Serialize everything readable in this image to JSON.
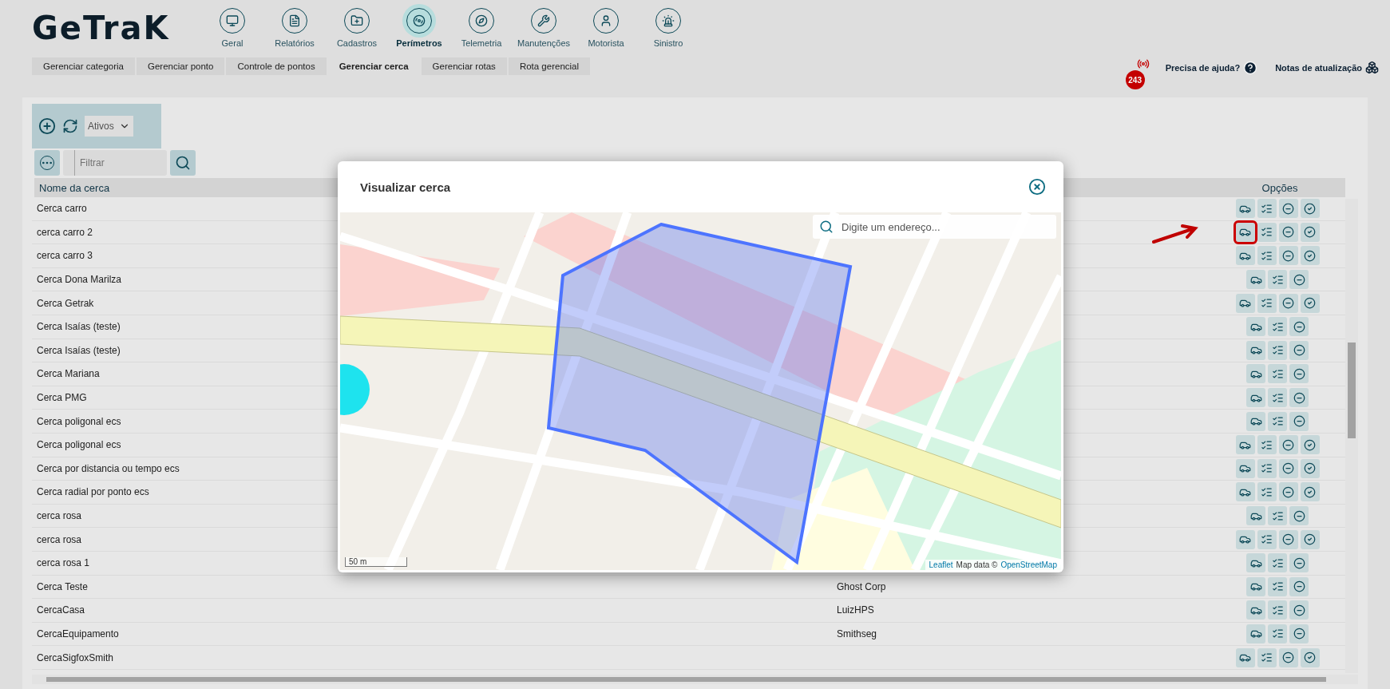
{
  "logo": "GeTraK",
  "nav": {
    "items": [
      {
        "label": "Geral",
        "selected": false
      },
      {
        "label": "Relatórios",
        "selected": false
      },
      {
        "label": "Cadastros",
        "selected": false
      },
      {
        "label": "Perímetros",
        "selected": true
      },
      {
        "label": "Telemetria",
        "selected": false
      },
      {
        "label": "Manutenções",
        "selected": false
      },
      {
        "label": "Motorista",
        "selected": false
      },
      {
        "label": "Sinistro",
        "selected": false
      }
    ]
  },
  "subtabs": [
    {
      "label": "Gerenciar categoria",
      "selected": false
    },
    {
      "label": "Gerenciar ponto",
      "selected": false
    },
    {
      "label": "Controle de pontos",
      "selected": false
    },
    {
      "label": "Gerenciar cerca",
      "selected": true
    },
    {
      "label": "Gerenciar rotas",
      "selected": false
    },
    {
      "label": "Rota gerencial",
      "selected": false
    }
  ],
  "alerts": {
    "badge": "243"
  },
  "help": {
    "label": "Precisa de ajuda?"
  },
  "release_notes": {
    "label": "Notas de atualização"
  },
  "toolbar": {
    "status_select": "Ativos",
    "filter": {
      "placeholder": "Filtrar"
    }
  },
  "table": {
    "columns": [
      "Nome da cerca",
      "Opções"
    ],
    "rows": [
      {
        "name": "Cerca carro",
        "check_option": true,
        "highlighted": false
      },
      {
        "name": "cerca carro 2",
        "check_option": true,
        "highlighted": true
      },
      {
        "name": "cerca carro 3",
        "check_option": true,
        "highlighted": false
      },
      {
        "name": "Cerca Dona Marilza",
        "check_option": false,
        "highlighted": false
      },
      {
        "name": "Cerca Getrak",
        "check_option": true,
        "highlighted": false
      },
      {
        "name": "Cerca Isaías (teste)",
        "check_option": false,
        "highlighted": false
      },
      {
        "name": "Cerca Isaías (teste)",
        "check_option": false,
        "highlighted": false
      },
      {
        "name": "Cerca Mariana",
        "check_option": false,
        "highlighted": false
      },
      {
        "name": "Cerca PMG",
        "check_option": false,
        "highlighted": false
      },
      {
        "name": "Cerca poligonal ecs",
        "check_option": false,
        "highlighted": false
      },
      {
        "name": "Cerca poligonal ecs",
        "check_option": true,
        "highlighted": false
      },
      {
        "name": "Cerca por distancia ou tempo ecs",
        "check_option": true,
        "highlighted": false
      },
      {
        "name": "Cerca radial por ponto ecs",
        "check_option": true,
        "highlighted": false
      },
      {
        "name": "cerca rosa",
        "check_option": false,
        "highlighted": false
      },
      {
        "name": "cerca rosa",
        "check_option": true,
        "highlighted": false
      },
      {
        "name": "cerca rosa 1",
        "check_option": false,
        "highlighted": false
      },
      {
        "name": "Cerca Teste",
        "column_2": "Ghost Corp",
        "check_option": false,
        "highlighted": false
      },
      {
        "name": "CercaCasa",
        "column_2": "LuizHPS",
        "check_option": false,
        "highlighted": false
      },
      {
        "name": "CercaEquipamento",
        "column_2": "Smithseg",
        "check_option": false,
        "highlighted": false
      },
      {
        "name": "CercaSigfoxSmith",
        "check_option": true,
        "highlighted": false
      }
    ]
  },
  "modal": {
    "title": "Visualizar cerca",
    "map": {
      "search_placeholder": "Digite um endereço...",
      "scale": "50 m",
      "attribution": {
        "leaflet": "Leaflet",
        "text": "Map data ©",
        "link": "OpenStreetMap"
      }
    }
  }
}
